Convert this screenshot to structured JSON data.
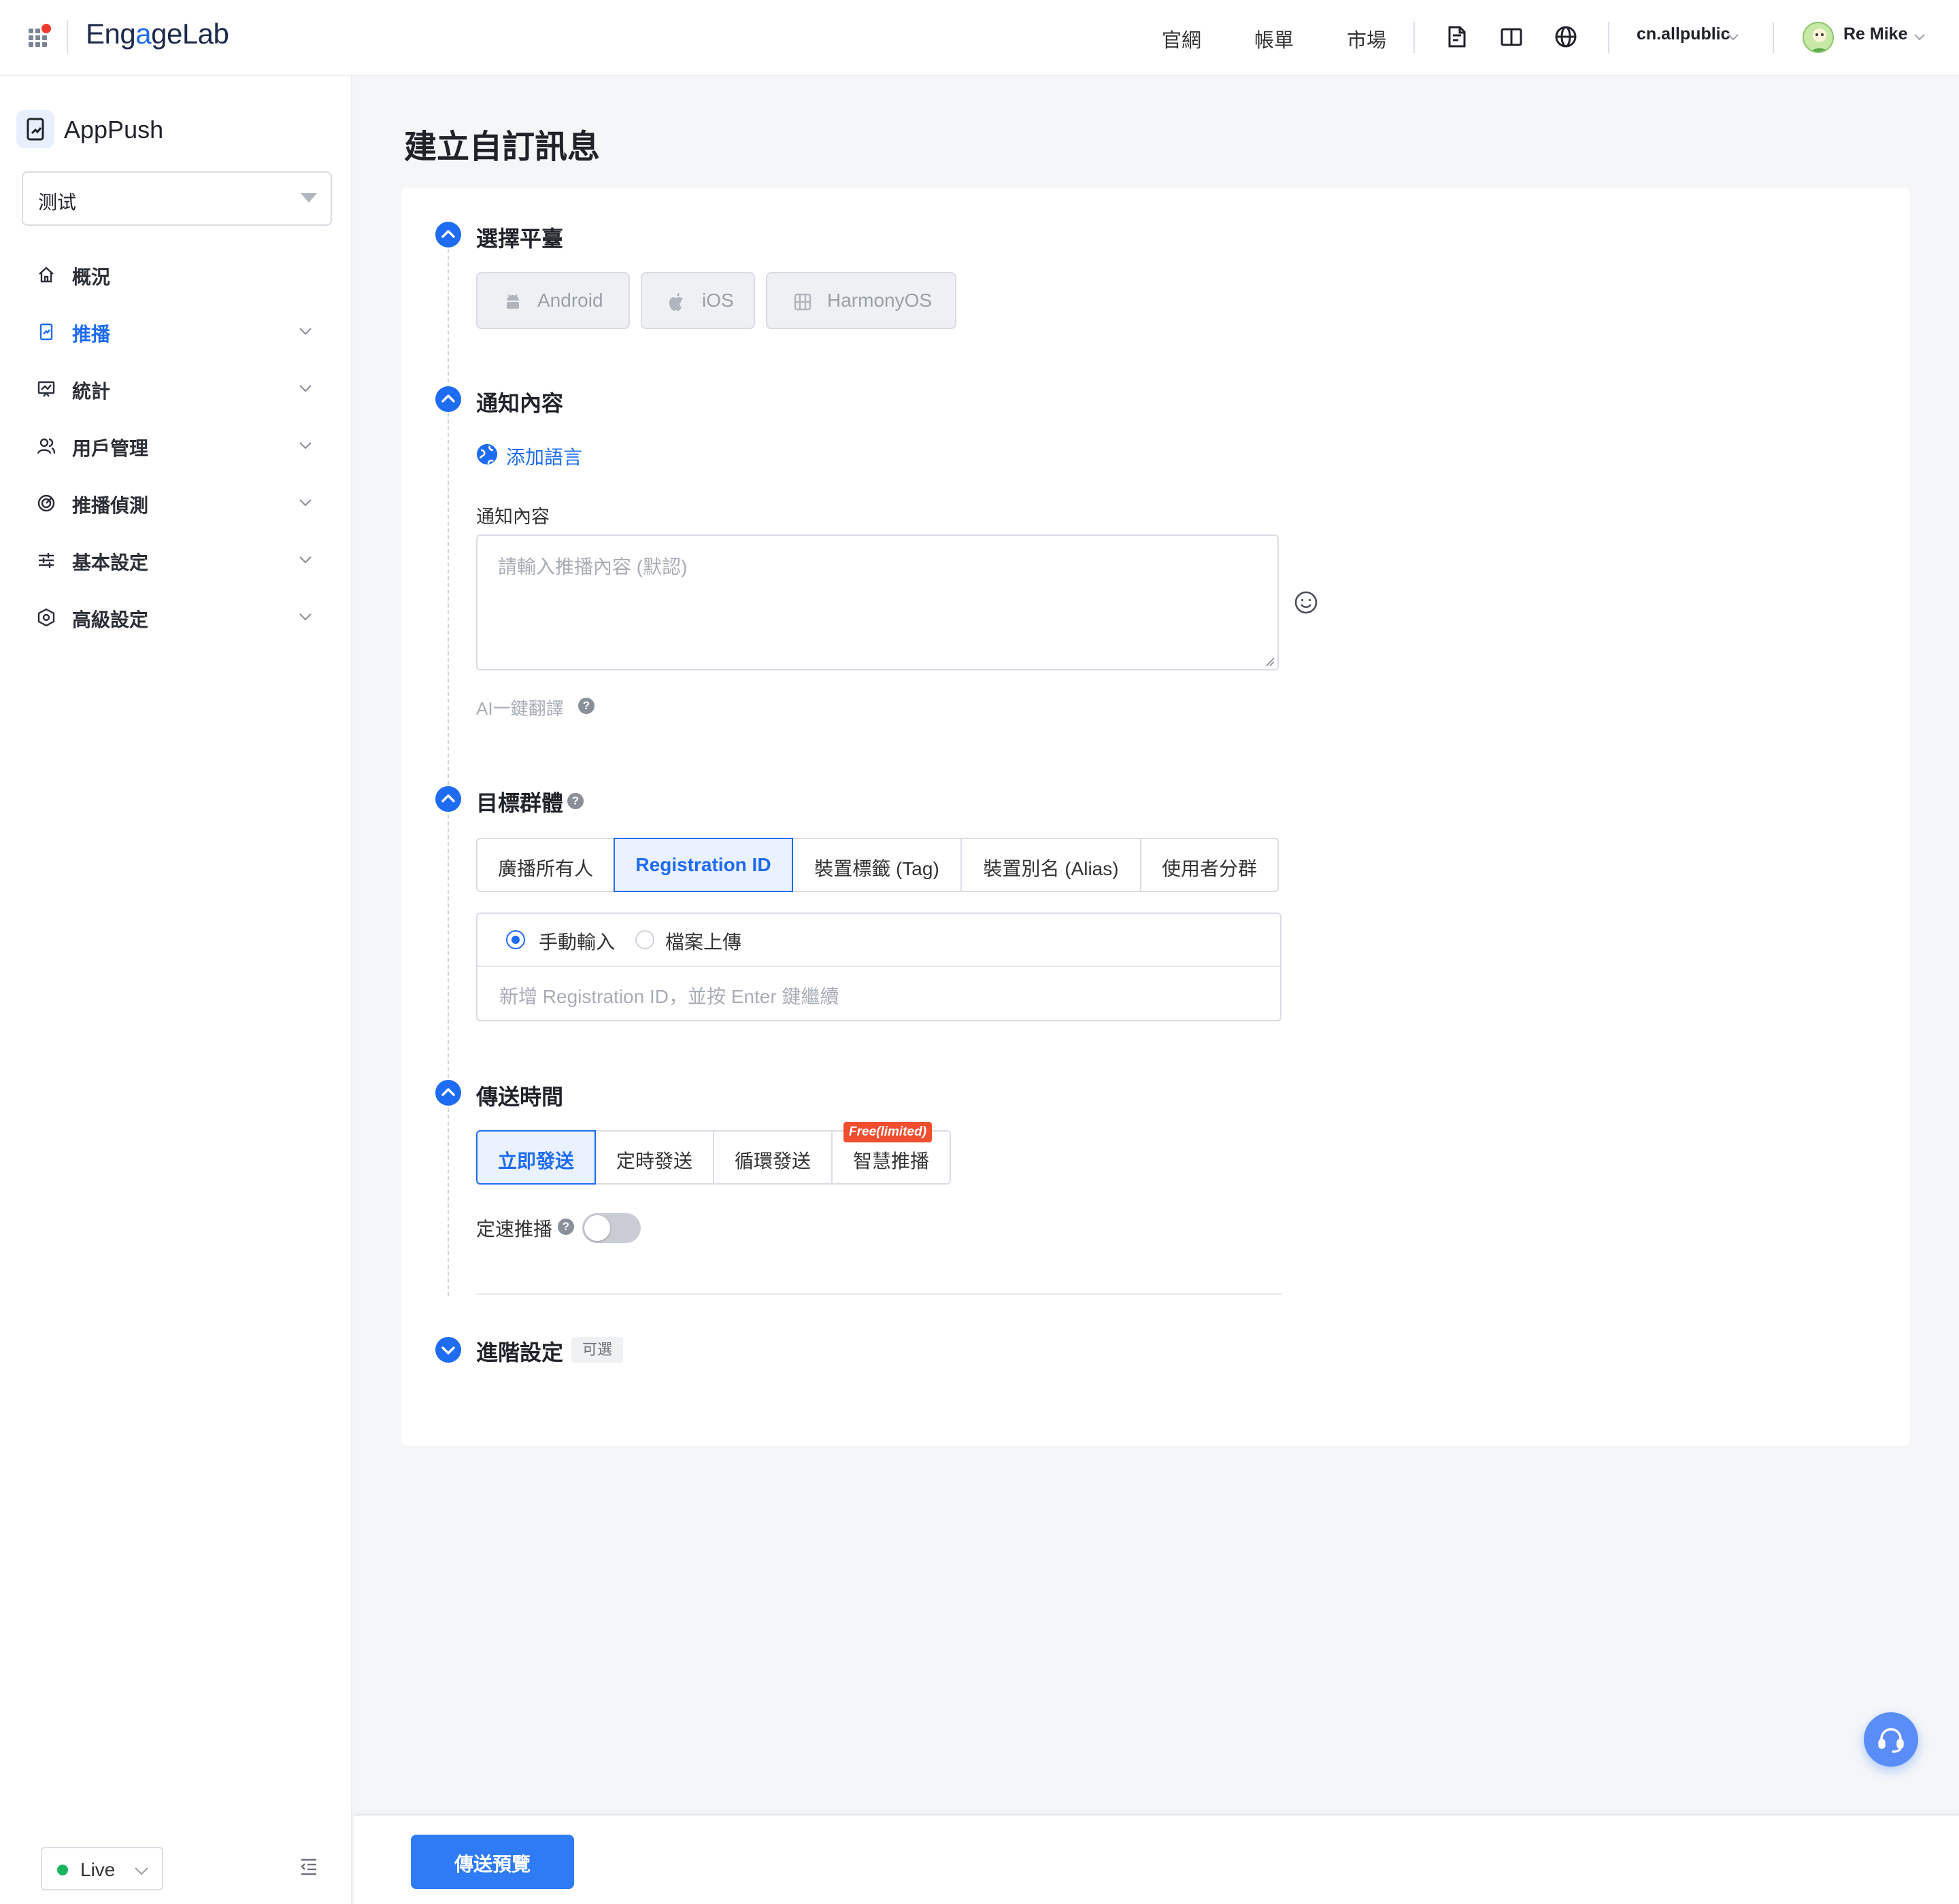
{
  "header": {
    "logo": {
      "prefix": "Eng",
      "mark": "a",
      "middle": "ge",
      "suffix": "Lab"
    },
    "nav": [
      "官網",
      "帳單",
      "市場"
    ],
    "workspace": "cn.allpublic",
    "user": "Re Mike",
    "icons": [
      "apps-grid-icon",
      "doc-icon",
      "book-icon",
      "globe-icon"
    ]
  },
  "sidebar": {
    "app_name": "AppPush",
    "project": "测试",
    "items": [
      {
        "label": "概況",
        "icon": "home-icon"
      },
      {
        "label": "推播",
        "icon": "push-icon",
        "active": true
      },
      {
        "label": "統計",
        "icon": "chart-icon"
      },
      {
        "label": "用戶管理",
        "icon": "users-icon"
      },
      {
        "label": "推播偵測",
        "icon": "radar-icon"
      },
      {
        "label": "基本設定",
        "icon": "sliders-icon"
      },
      {
        "label": "高級設定",
        "icon": "hexagon-settings-icon"
      }
    ],
    "env": "Live"
  },
  "page": {
    "title": "建立自訂訊息",
    "sections": {
      "platform": {
        "title": "選擇平臺",
        "options": [
          "Android",
          "iOS",
          "HarmonyOS"
        ]
      },
      "content": {
        "title": "通知內容",
        "add_language": "添加語言",
        "field_label": "通知內容",
        "placeholder": "請輸入推播內容 (默認)",
        "ai_translate": "AI一鍵翻譯"
      },
      "target": {
        "title": "目標群體",
        "tabs": [
          "廣播所有人",
          "Registration ID",
          "裝置標籤 (Tag)",
          "裝置別名 (Alias)",
          "使用者分群"
        ],
        "selected_tab": "Registration ID",
        "input_modes": [
          "手動輸入",
          "檔案上傳"
        ],
        "selected_mode": "手動輸入",
        "reg_placeholder": "新增 Registration ID，並按 Enter 鍵繼續"
      },
      "schedule": {
        "title": "傳送時間",
        "options": [
          "立即發送",
          "定時發送",
          "循環發送",
          "智慧推播"
        ],
        "selected": "立即發送",
        "badge": "Free(limited)",
        "rate_limit_label": "定速推播",
        "rate_limit_on": false
      },
      "advanced": {
        "title": "進階設定",
        "tag": "可選"
      }
    },
    "submit_label": "傳送預覽"
  },
  "colors": {
    "primary": "#1e6cf1",
    "button": "#2f7bf5",
    "badge": "#f04e2e",
    "live": "#19b45f"
  }
}
